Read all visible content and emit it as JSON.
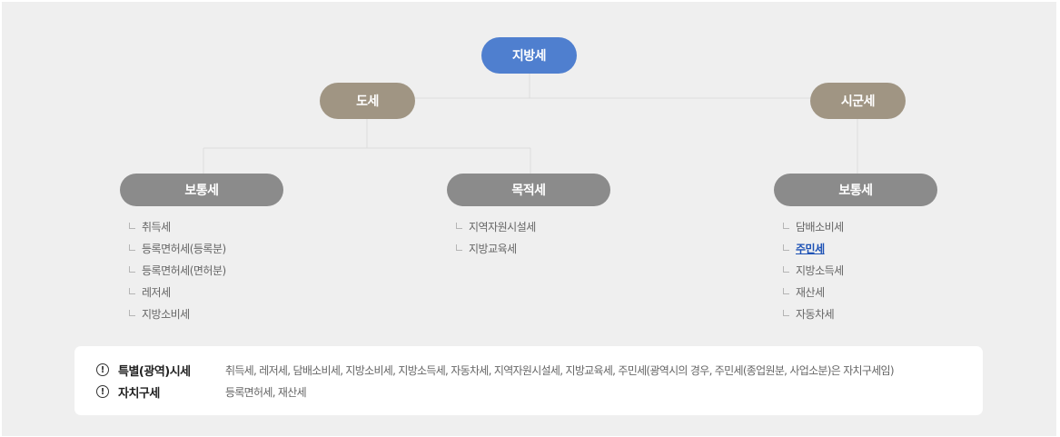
{
  "root": {
    "label": "지방세"
  },
  "branches": [
    {
      "label": "도세",
      "children": [
        {
          "label": "보통세",
          "items": [
            "취득세",
            "등록면허세(등록분)",
            "등록면허세(면허분)",
            "레저세",
            "지방소비세"
          ]
        },
        {
          "label": "목적세",
          "items": [
            "지역자원시설세",
            "지방교육세"
          ]
        }
      ]
    },
    {
      "label": "시군세",
      "children": [
        {
          "label": "보통세",
          "items": [
            "담배소비세",
            "주민세",
            "지방소득세",
            "재산세",
            "자동차세"
          ],
          "link_item": "주민세"
        }
      ]
    }
  ],
  "notes": [
    {
      "icon": "!",
      "title": "특별(광역)시세",
      "text": "취득세, 레저세, 담배소비세, 지방소비세, 지방소득세, 자동차세, 지역자원시설세, 지방교육세, 주민세(광역시의 경우, 주민세(종업원분, 사업소분)은 자치구세임)"
    },
    {
      "icon": "!",
      "title": "자치구세",
      "text": "등록면허세, 재산세"
    }
  ],
  "colors": {
    "root": "#4f7fcf",
    "branch": "#a09583",
    "category": "#8b8b8b",
    "link": "#1c51b5",
    "connector": "#dcdcdc",
    "background": "#efefef"
  }
}
